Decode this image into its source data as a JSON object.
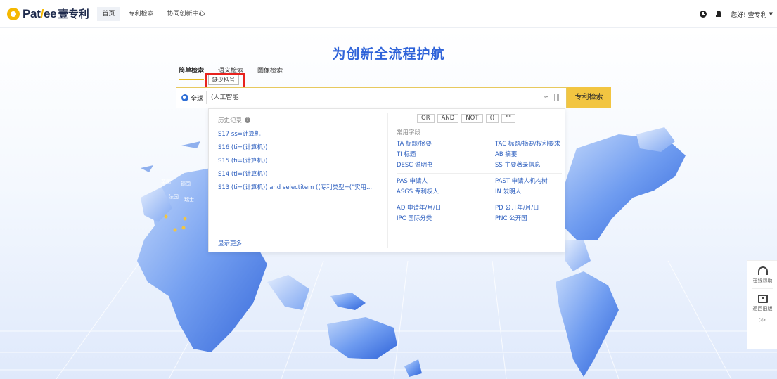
{
  "brand": {
    "pat": "Pat",
    "slash": "/",
    "yee": "ee",
    "cn": "壹专利"
  },
  "nav": {
    "items": [
      "首页",
      "专利检索",
      "协同创新中心"
    ]
  },
  "user": {
    "greeting": "您好! 壹专利",
    "caret": "▼"
  },
  "hero": {
    "title": "为创新全流程护航"
  },
  "tabs": [
    "简单检索",
    "语义检索",
    "图像检索"
  ],
  "tooltip": {
    "text": "缺少括号"
  },
  "search": {
    "scope": "全球",
    "query": "(人工智能",
    "approx": "≈",
    "bars": "|||||",
    "button": "专利检索"
  },
  "history": {
    "title": "历史记录",
    "help": "?",
    "items": [
      "S17 ss=计算机",
      "S16 (ti=(计算机))",
      "S15 (ti=(计算机))",
      "S14 (ti=(计算机))",
      "S13 (ti=(计算机)) and selectitem ((专利类型=(\"实用..."
    ],
    "more": "显示更多"
  },
  "operators": [
    "OR",
    "AND",
    "NOT",
    "()",
    "\"\""
  ],
  "fields": {
    "title": "常用字段",
    "groups": [
      [
        "TA 标题/摘要",
        "TAC 标题/摘要/权利要求",
        "TI 标题",
        "AB 摘要",
        "DESC 说明书",
        "SS 主要著录信息"
      ],
      [
        "PAS 申请人",
        "PAST 申请人机构树",
        "ASGS 专利权人",
        "IN 发明人"
      ],
      [
        "AD 申请年/月/日",
        "PD 公开年/月/日",
        "IPC 国际分类",
        "PNC 公开国"
      ]
    ]
  },
  "float_panel": {
    "help": "在线帮助",
    "old": "返回旧版",
    "chevron": "≫"
  },
  "map_labels": [
    "英国",
    "德国",
    "法国",
    "瑞士"
  ],
  "colors": {
    "accent": "#f2c541",
    "title": "#2f63d9",
    "link": "#2d5fbf",
    "alert": "#e8231e"
  }
}
